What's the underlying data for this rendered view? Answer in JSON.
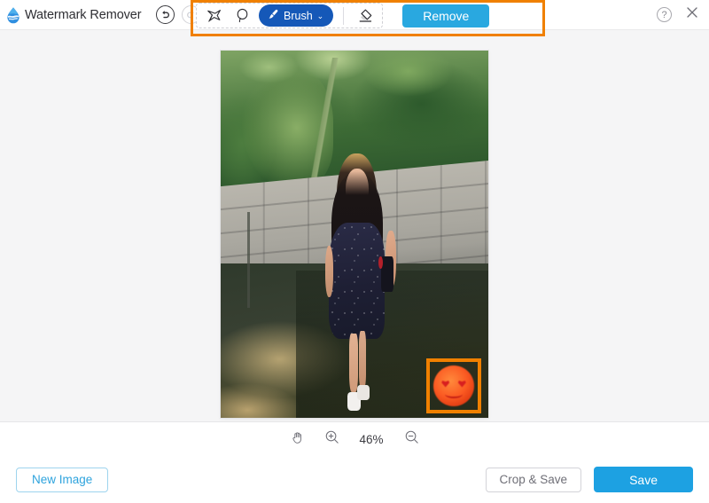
{
  "app": {
    "title": "Watermark Remover",
    "logo_icon": "water-drop-logo"
  },
  "topbar": {
    "undo_icon": "undo-arrow-icon",
    "redo_icon": "redo-arrow-icon",
    "help_label": "?",
    "help_icon": "help-circle-icon",
    "close_icon": "close-x-icon"
  },
  "toolbar": {
    "tools": [
      {
        "name": "polygonal-lasso-tool",
        "icon": "polygonal-lasso-icon",
        "active": false
      },
      {
        "name": "free-lasso-tool",
        "icon": "free-lasso-icon",
        "active": false
      },
      {
        "name": "brush-tool",
        "icon": "brush-icon",
        "label": "Brush",
        "chevron": "⌄",
        "active": true
      },
      {
        "name": "eraser-tool",
        "icon": "eraser-icon",
        "active": false
      }
    ],
    "remove_label": "Remove",
    "highlight_color": "#f08000",
    "brush_pill_color": "#1558b8",
    "remove_button_color": "#29a8e0"
  },
  "canvas": {
    "background": "#f5f5f6",
    "image_alt": "Woman in dark floral dress standing beside concrete block wall with palm trees",
    "selection": {
      "name": "watermark-selection-box",
      "color": "#f08000",
      "content": "heart-eyes-emoji-watermark"
    }
  },
  "zoombar": {
    "pan_icon": "hand-pan-icon",
    "zoom_in_icon": "zoom-in-icon",
    "zoom_out_icon": "zoom-out-icon",
    "zoom_level": "46%"
  },
  "footer": {
    "new_image_label": "New Image",
    "crop_save_label": "Crop & Save",
    "save_label": "Save",
    "save_button_color": "#1da1e2"
  }
}
